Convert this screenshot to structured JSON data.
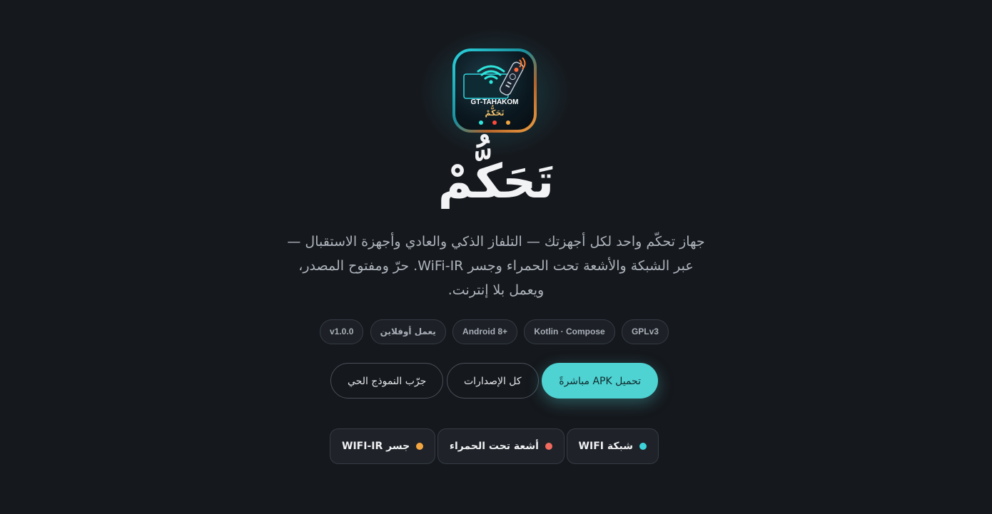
{
  "app": {
    "icon_brand": "GT-TAHAKOM",
    "icon_arabic": "تَحَكُّمْ",
    "title": "تَحَكُّمْ",
    "description": "جهاز تحكّم واحد لكل أجهزتك — التلفاز الذكي والعادي وأجهزة الاستقبال — عبر الشبكة والأشعة تحت الحمراء وجسر WiFi-IR. حرّ ومفتوح المصدر، ويعمل بلا إنترنت."
  },
  "badges": [
    "GPLv3",
    "Kotlin · Compose",
    "Android 8+",
    "يعمل أوفلاين",
    "v1.0.0"
  ],
  "buttons": {
    "download_apk": "تحميل APK مباشرةً",
    "all_releases": "كل الإصدارات",
    "live_demo": "جرّب النموذج الحي"
  },
  "features": [
    {
      "label": "شبكة WIFI",
      "color": "#3dd3d8"
    },
    {
      "label": "أشعة تحت الحمراء",
      "color": "#f06a5e"
    },
    {
      "label": "جسر WIFI-IR",
      "color": "#f2a540"
    }
  ],
  "colors": {
    "background": "#15181d",
    "accent": "#4fd2d2"
  }
}
